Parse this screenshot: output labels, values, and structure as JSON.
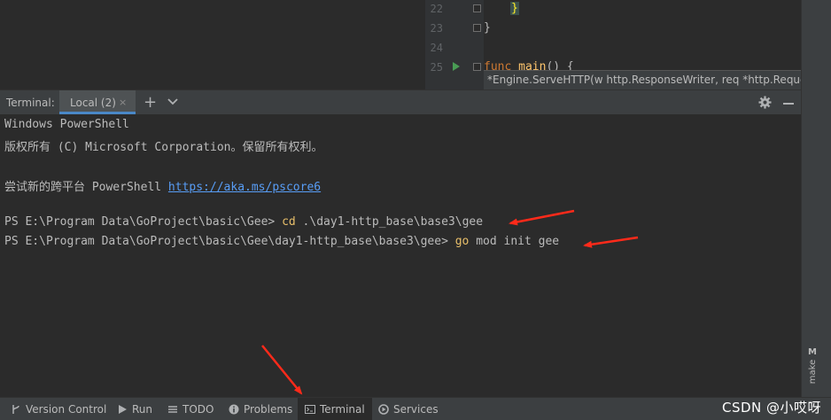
{
  "editor": {
    "line_numbers": [
      "22",
      "23",
      "24",
      "25"
    ],
    "line22_code": "}",
    "line23_code": "}",
    "line25_keyword": "func",
    "line25_name": "main",
    "line25_rest": "() {",
    "tooltip": "*Engine.ServeHTTP(w http.ResponseWriter, req *http.Request"
  },
  "terminal": {
    "title": "Terminal:",
    "tab_label": "Local (2)",
    "tab_close": "×",
    "add_tab": "+",
    "lines": {
      "l1": "Windows PowerShell",
      "l2": "版权所有 (C) Microsoft Corporation。保留所有权利。",
      "l3_prefix": "尝试新的跨平台 PowerShell ",
      "l3_link": "https://aka.ms/pscore6",
      "l4_prompt": "PS E:\\Program Data\\GoProject\\basic\\Gee> ",
      "l4_cmd": "cd",
      "l4_args": " .\\day1-http_base\\base3\\gee",
      "l5_prompt": "PS E:\\Program Data\\GoProject\\basic\\Gee\\day1-http_base\\base3\\gee> ",
      "l5_cmd": "go",
      "l5_args": " mod init gee"
    }
  },
  "toolbar": {
    "version_control": "Version Control",
    "run": "Run",
    "todo": "TODO",
    "problems": "Problems",
    "terminal": "Terminal",
    "services": "Services"
  },
  "side": {
    "make_m": "M",
    "make": "make"
  },
  "watermark": "CSDN @小哎呀",
  "colors": {
    "background": "#2b2b2b",
    "panel": "#3c3f41",
    "command": "#e8bf6a",
    "link": "#589df6",
    "accent_tab": "#4a88c7",
    "annotation_arrow": "#ff2a1a"
  }
}
